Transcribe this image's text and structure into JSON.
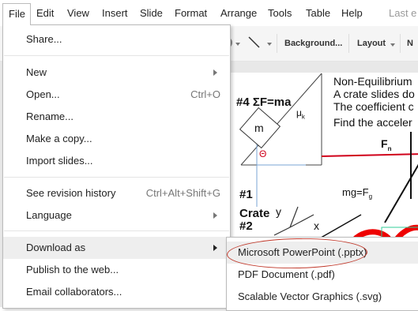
{
  "menubar": {
    "items": [
      "File",
      "Edit",
      "View",
      "Insert",
      "Slide",
      "Format",
      "Arrange",
      "Tools",
      "Table",
      "Help"
    ],
    "last_edit": "Last e"
  },
  "toolbar": {
    "background_label": "Background...",
    "layout_label": "Layout",
    "more_label": "N"
  },
  "file_menu": {
    "share": "Share...",
    "new": "New",
    "open": "Open...",
    "open_shortcut": "Ctrl+O",
    "rename": "Rename...",
    "make_copy": "Make a copy...",
    "import_slides": "Import slides...",
    "revision_history": "See revision history",
    "revision_shortcut": "Ctrl+Alt+Shift+G",
    "language": "Language",
    "download_as": "Download as",
    "publish": "Publish to the web...",
    "email_collaborators": "Email collaborators..."
  },
  "download_submenu": {
    "pptx": "Microsoft PowerPoint (.pptx)",
    "pdf": "PDF Document (.pdf)",
    "svg": "Scalable Vector Graphics (.svg)"
  },
  "slide": {
    "line1": "Non-Equilibrium",
    "line2": "A crate slides do",
    "line3": "The coefficient c",
    "line4": "Find the acceler",
    "title_eq": "#4 ΣF=ma",
    "mass": "m",
    "mu": "μ",
    "mu_sub": "k",
    "theta": "Θ",
    "fn": "F",
    "fn_sub": "n",
    "label1": "#1",
    "crate": "Crate",
    "label2": "#2",
    "mg": "mg=F",
    "mg_sub": "g",
    "y_axis": "y",
    "x_axis": "x"
  },
  "colors": {
    "menu_highlight": "#eeeeee",
    "annotation_red": "#c0392b"
  }
}
